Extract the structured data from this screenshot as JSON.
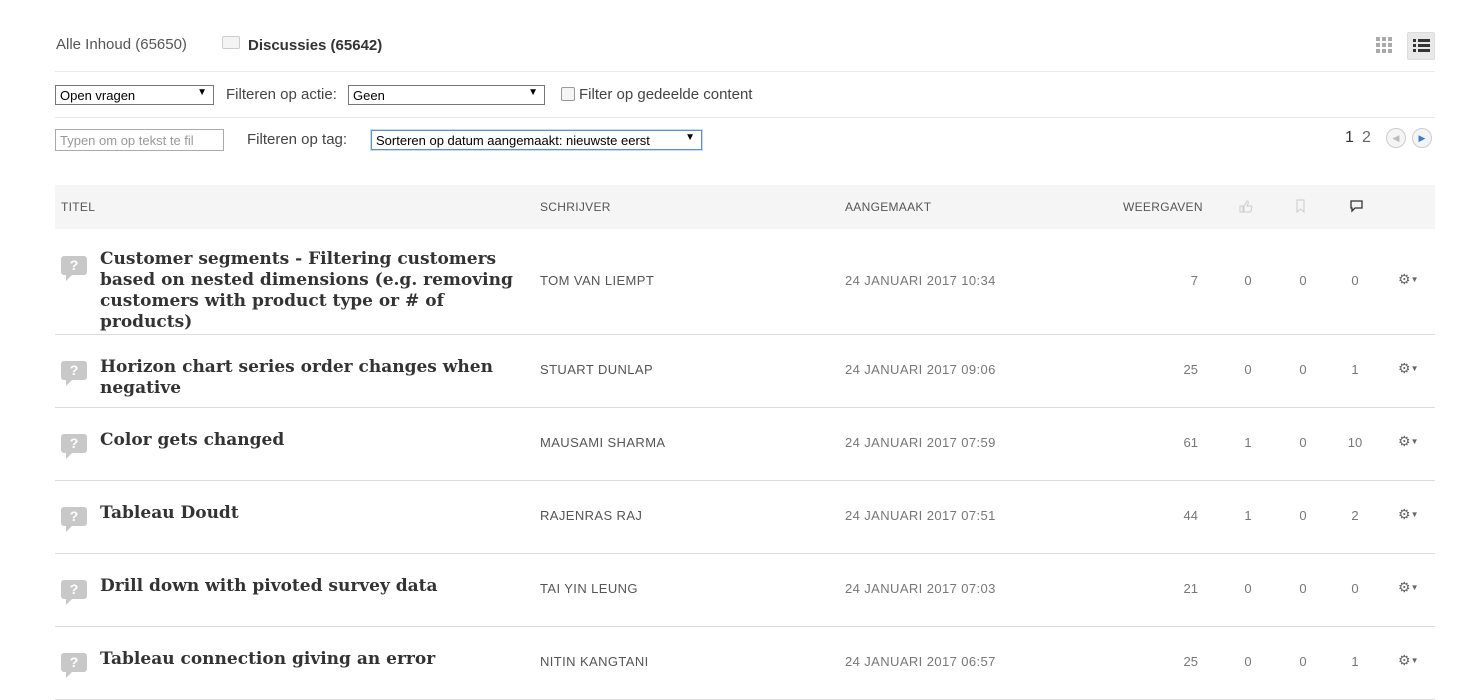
{
  "header": {
    "tab_all": "Alle Inhoud (65650)",
    "tab_discussions": "Discussies (65642)"
  },
  "filters": {
    "type_select": "Open vragen",
    "action_label": "Filteren op actie:",
    "action_select": "Geen",
    "shared_label": "Filter op gedeelde content",
    "text_placeholder": "Typen om op tekst te fil",
    "tag_label": "Filteren op tag:",
    "sort_select": "Sorteren op datum aangemaakt: nieuwste eerst"
  },
  "pagination": {
    "current": "1",
    "next": "2"
  },
  "table": {
    "headers": {
      "title": "TITEL",
      "author": "SCHRIJVER",
      "created": "AANGEMAAKT",
      "views": "WEERGAVEN"
    },
    "rows": [
      {
        "title": "Customer segments - Filtering customers based on nested dimensions (e.g. removing customers with product type or # of products)",
        "author": "TOM VAN LIEMPT",
        "created": "24 JANUARI 2017 10:34",
        "views": "7",
        "likes": "0",
        "bookmarks": "0",
        "replies": "0"
      },
      {
        "title": "Horizon chart series order changes when negative",
        "author": "STUART DUNLAP",
        "created": "24 JANUARI 2017 09:06",
        "views": "25",
        "likes": "0",
        "bookmarks": "0",
        "replies": "1"
      },
      {
        "title": "Color gets changed",
        "author": "MAUSAMI SHARMA",
        "created": "24 JANUARI 2017 07:59",
        "views": "61",
        "likes": "1",
        "bookmarks": "0",
        "replies": "10"
      },
      {
        "title": "Tableau Doudt",
        "author": "RAJENRAS RAJ",
        "created": "24 JANUARI 2017 07:51",
        "views": "44",
        "likes": "1",
        "bookmarks": "0",
        "replies": "2"
      },
      {
        "title": "Drill down with pivoted survey data",
        "author": "TAI YIN LEUNG",
        "created": "24 JANUARI 2017 07:03",
        "views": "21",
        "likes": "0",
        "bookmarks": "0",
        "replies": "0"
      },
      {
        "title": "Tableau connection giving an error",
        "author": "NITIN KANGTANI",
        "created": "24 JANUARI 2017 06:57",
        "views": "25",
        "likes": "0",
        "bookmarks": "0",
        "replies": "1"
      }
    ]
  },
  "icons": {
    "grid_view": "grid-icon",
    "list_view": "list-icon",
    "discussion": "speech-bubble-icon",
    "question": "question-bubble-icon",
    "like": "thumbs-up-icon",
    "bookmark": "bookmark-icon",
    "reply": "comment-icon",
    "actions": "gear-icon"
  }
}
